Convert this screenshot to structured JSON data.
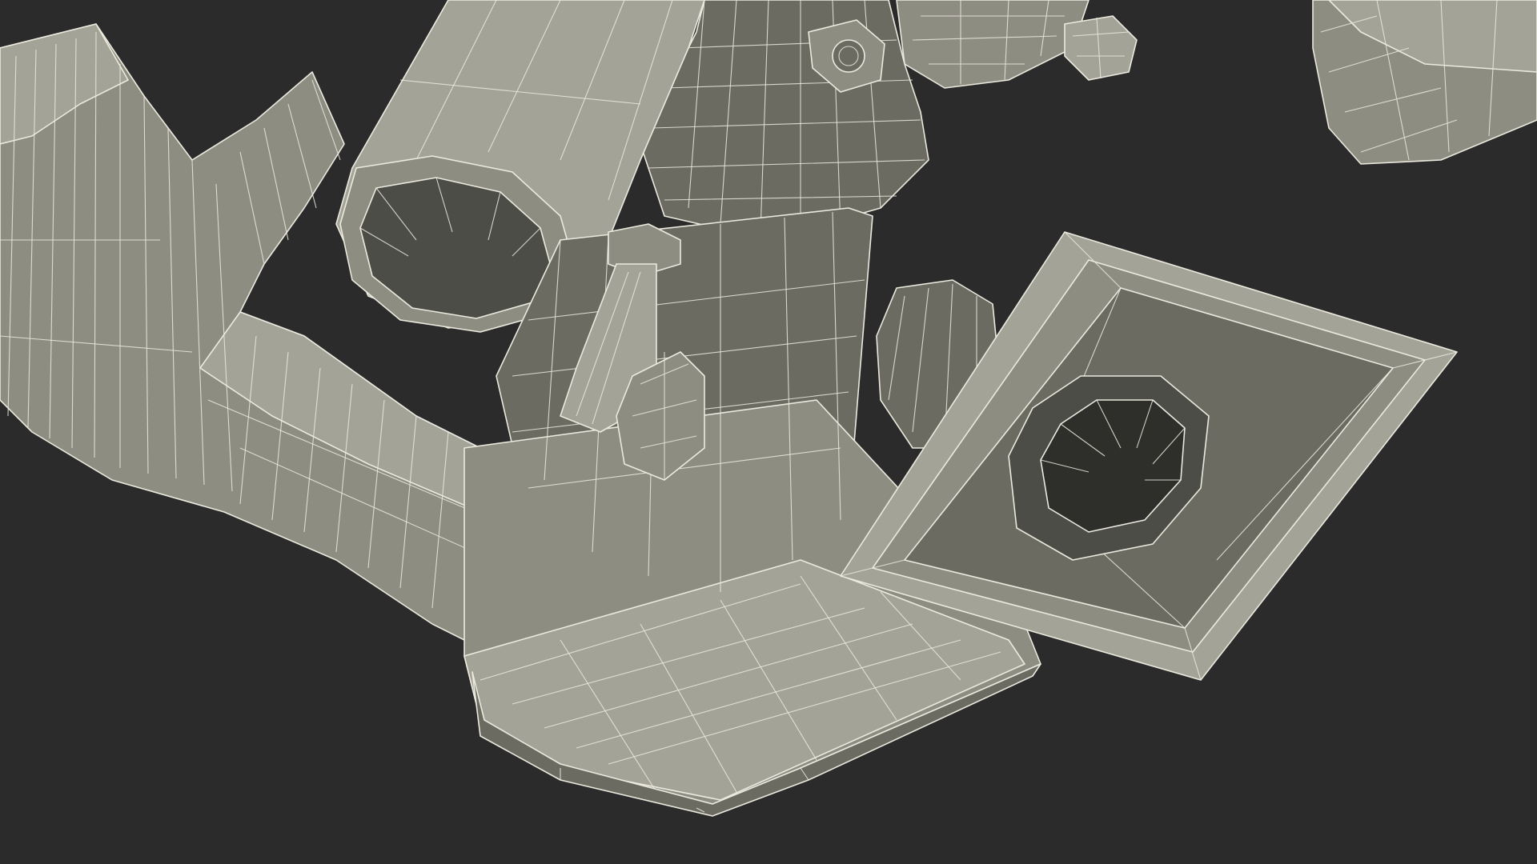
{
  "scene": {
    "background": "#2b2b2b",
    "mesh_fill_light": "#a3a398",
    "mesh_fill_mid": "#8d8d82",
    "mesh_fill_shadow": "#6b6b62",
    "mesh_fill_inner": "#4d4d47",
    "mesh_hole": "#2e2e2b",
    "wire_color": "#eceadf"
  }
}
